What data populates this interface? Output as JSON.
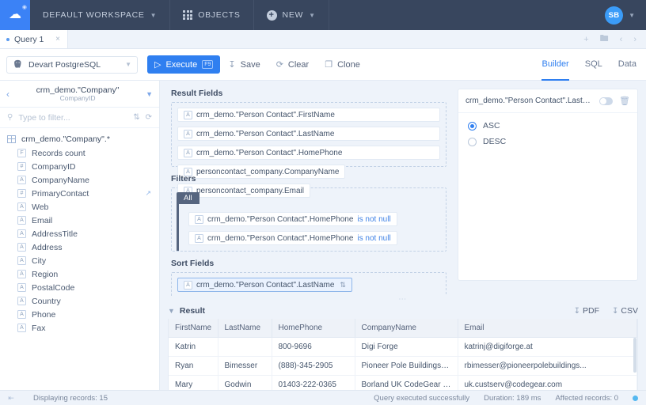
{
  "topbar": {
    "logo_icon": "cloud-icon",
    "workspace_label": "DEFAULT WORKSPACE",
    "objects_label": "OBJECTS",
    "new_label": "NEW",
    "avatar_initials": "SB",
    "accent": "#3b82f6",
    "bg": "#38465e"
  },
  "tabstrip": {
    "tab_label": "Query 1",
    "close_label": "×",
    "icons": [
      "plus-icon",
      "folder-icon",
      "chevron-left-icon",
      "chevron-right-icon"
    ]
  },
  "toolbar": {
    "connection": "Devart PostgreSQL",
    "execute_label": "Execute",
    "execute_shortcut": "F9",
    "save_label": "Save",
    "clear_label": "Clear",
    "clone_label": "Clone",
    "modes": [
      {
        "label": "Builder",
        "active": true
      },
      {
        "label": "SQL",
        "active": false
      },
      {
        "label": "Data",
        "active": false
      }
    ]
  },
  "sidebar": {
    "header_title": "crm_demo.\"Company\"",
    "header_subtitle": "CompanyID",
    "filter_placeholder": "Type to filter...",
    "tree_root": "crm_demo.\"Company\".*",
    "fields": [
      {
        "type": "F",
        "label": "Records count"
      },
      {
        "type": "#",
        "label": "CompanyID"
      },
      {
        "type": "A",
        "label": "CompanyName"
      },
      {
        "type": "#",
        "label": "PrimaryContact",
        "link": true
      },
      {
        "type": "A",
        "label": "Web"
      },
      {
        "type": "A",
        "label": "Email"
      },
      {
        "type": "A",
        "label": "AddressTitle"
      },
      {
        "type": "A",
        "label": "Address"
      },
      {
        "type": "A",
        "label": "City"
      },
      {
        "type": "A",
        "label": "Region"
      },
      {
        "type": "A",
        "label": "PostalCode"
      },
      {
        "type": "A",
        "label": "Country"
      },
      {
        "type": "A",
        "label": "Phone"
      },
      {
        "type": "A",
        "label": "Fax"
      }
    ]
  },
  "builder": {
    "result_fields_title": "Result Fields",
    "result_fields": [
      {
        "type": "A",
        "label": "crm_demo.\"Person Contact\".FirstName"
      },
      {
        "type": "A",
        "label": "crm_demo.\"Person Contact\".LastName"
      },
      {
        "type": "A",
        "label": "crm_demo.\"Person Contact\".HomePhone"
      },
      {
        "type": "A",
        "label": "personcontact_company.CompanyName"
      },
      {
        "type": "A",
        "label": "personcontact_company.Email"
      }
    ],
    "filters_title": "Filters",
    "filters_group_label": "All",
    "filters": [
      {
        "type": "A",
        "label": "crm_demo.\"Person Contact\".HomePhone",
        "operator": "is not null"
      },
      {
        "type": "A",
        "label": "crm_demo.\"Person Contact\".HomePhone",
        "operator": "is not null"
      }
    ],
    "sort_fields_title": "Sort Fields",
    "sort_fields": [
      {
        "type": "A",
        "label": "crm_demo.\"Person Contact\".LastName",
        "sort_icon": "sort-asc-icon"
      }
    ]
  },
  "properties": {
    "field_name": "crm_demo.\"Person Contact\".LastName",
    "toggle_state": "off",
    "delete_icon": "trash-icon",
    "options": [
      {
        "label": "ASC",
        "selected": true
      },
      {
        "label": "DESC",
        "selected": false
      }
    ]
  },
  "result": {
    "title": "Result",
    "export": [
      {
        "label": "PDF",
        "icon": "download-icon"
      },
      {
        "label": "CSV",
        "icon": "download-icon"
      }
    ],
    "columns": [
      "FirstName",
      "LastName",
      "HomePhone",
      "CompanyName",
      "Email"
    ],
    "rows": [
      [
        "Katrin",
        "",
        "800-9696",
        "Digi Forge",
        "katrinj@digiforge.at"
      ],
      [
        "Ryan",
        "Bimesser",
        "(888)-345-2905",
        "Pioneer Pole Buildings, Inc.",
        "rbimesser@pioneerpolebuildings..."
      ],
      [
        "Mary",
        "Godwin",
        "01403-222-0365",
        "Borland UK CodeGear Division",
        "uk.custserv@codegear.com"
      ]
    ]
  },
  "statusbar": {
    "displaying": "Displaying records: 15",
    "query_status": "Query executed successfully",
    "duration": "Duration: 189 ms",
    "affected": "Affected records: 0",
    "indicator_color": "#55b8f0"
  }
}
